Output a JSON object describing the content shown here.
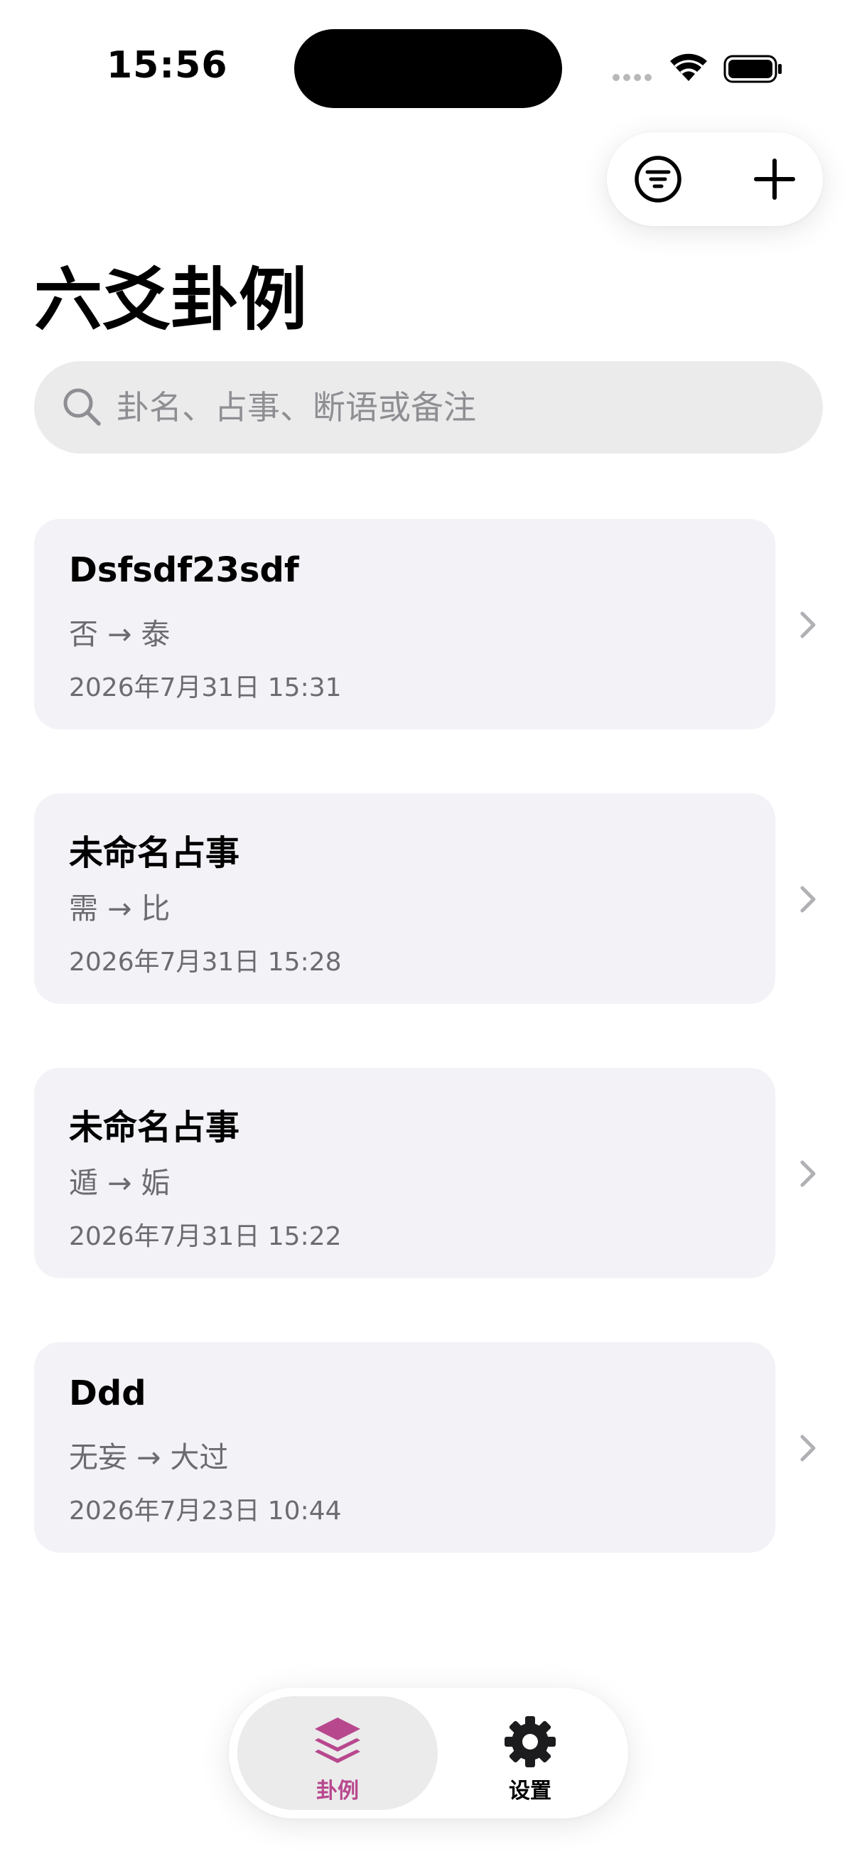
{
  "status_bar": {
    "time": "15:56"
  },
  "toolbar": {
    "filter_icon": "filter-icon",
    "add_icon": "plus-icon"
  },
  "page": {
    "title": "六爻卦例"
  },
  "search": {
    "placeholder": "卦名、占事、断语或备注",
    "value": ""
  },
  "cases": [
    {
      "title": "Dsfsdf23sdf",
      "hexagrams": "否 → 泰",
      "date": "2026年7月31日 15:31"
    },
    {
      "title": "未命名占事",
      "hexagrams": "需 → 比",
      "date": "2026年7月31日 15:28"
    },
    {
      "title": "未命名占事",
      "hexagrams": "遁 → 姤",
      "date": "2026年7月31日 15:22"
    },
    {
      "title": "Ddd",
      "hexagrams": "无妄 → 大过",
      "date": "2026年7月23日 10:44"
    }
  ],
  "tab_bar": {
    "tabs": [
      {
        "label": "卦例",
        "icon": "layers-icon",
        "active": true
      },
      {
        "label": "设置",
        "icon": "gear-icon",
        "active": false
      }
    ]
  },
  "colors": {
    "accent": "#b8488e",
    "card_background": "#f2f2f7",
    "search_background": "#ebebeb",
    "secondary_text": "#6c6c70"
  }
}
